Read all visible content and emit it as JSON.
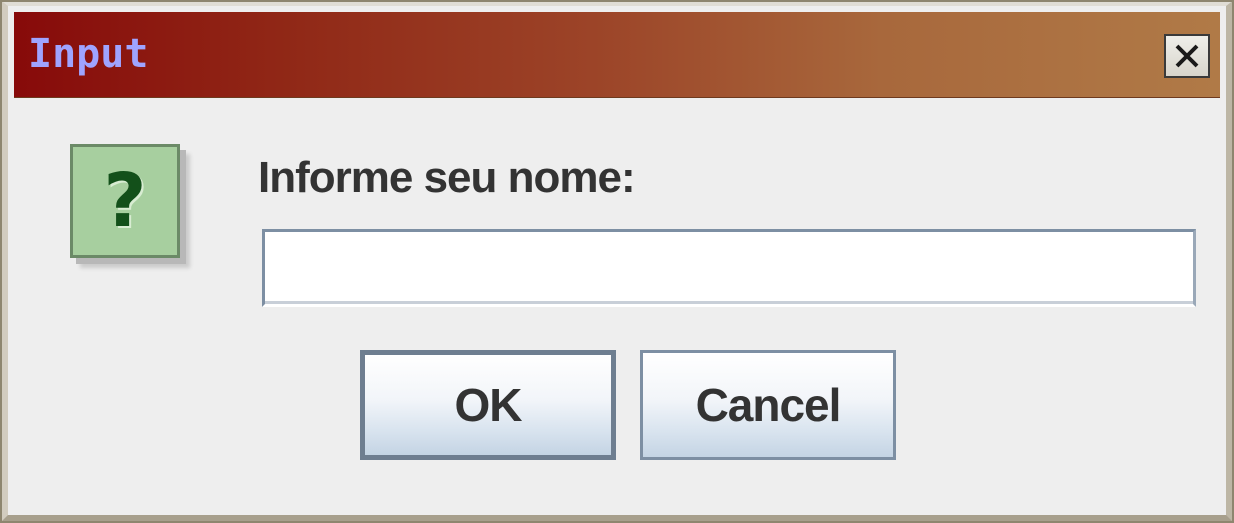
{
  "window": {
    "title": "Input",
    "close_icon": "close-x-icon"
  },
  "message": {
    "icon": "question-icon",
    "icon_glyph": "?",
    "prompt": "Informe seu nome:"
  },
  "name_field": {
    "value": "",
    "placeholder": ""
  },
  "buttons": {
    "ok_label": "OK",
    "cancel_label": "Cancel"
  },
  "colors": {
    "title_text": "#9fa4ff",
    "title_gradient_start": "#870a0a",
    "title_gradient_end": "#b07a47",
    "icon_background": "#a7cf9f",
    "icon_glyph": "#13501a",
    "dialog_background": "#eeeeee"
  }
}
